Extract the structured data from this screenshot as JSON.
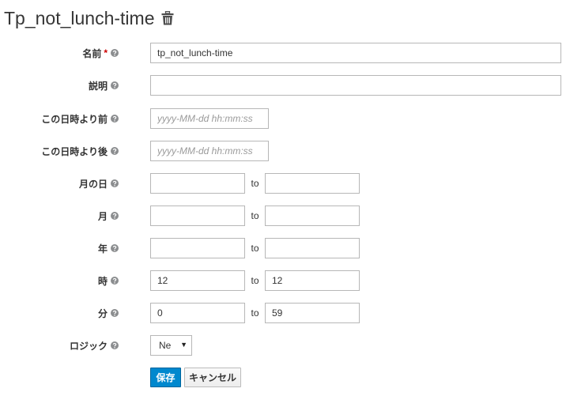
{
  "page": {
    "title": "Tp_not_lunch-time"
  },
  "icons": {
    "delete": "trash-icon",
    "help": "question-circle-icon"
  },
  "colors": {
    "primary": "#0088ce",
    "required": "#cc0000"
  },
  "form": {
    "rows": [
      {
        "label": "名前",
        "required": true,
        "kind": "text",
        "value": "tp_not_lunch-time"
      },
      {
        "label": "説明",
        "kind": "text",
        "value": ""
      },
      {
        "label": "この日時より前",
        "kind": "date",
        "value": "",
        "placeholder": "yyyy-MM-dd hh:mm:ss"
      },
      {
        "label": "この日時より後",
        "kind": "date",
        "value": "",
        "placeholder": "yyyy-MM-dd hh:mm:ss"
      },
      {
        "label": "月の日",
        "kind": "range",
        "from": "",
        "separator": "to",
        "to": ""
      },
      {
        "label": "月",
        "kind": "range",
        "from": "",
        "separator": "to",
        "to": ""
      },
      {
        "label": "年",
        "kind": "range",
        "from": "",
        "separator": "to",
        "to": ""
      },
      {
        "label": "時",
        "kind": "range",
        "from": "12",
        "separator": "to",
        "to": "12"
      },
      {
        "label": "分",
        "kind": "range",
        "from": "0",
        "separator": "to",
        "to": "59"
      },
      {
        "label": "ロジック",
        "kind": "select",
        "value": "Ne"
      }
    ]
  },
  "actions": {
    "save_label": "保存",
    "cancel_label": "キャンセル"
  }
}
